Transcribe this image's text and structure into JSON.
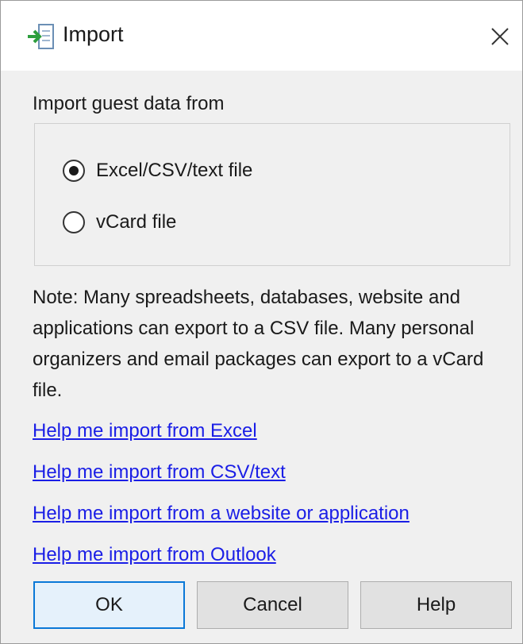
{
  "window": {
    "title": "Import",
    "title_icon": "import-arrow-icon",
    "close_icon": "close-icon"
  },
  "group": {
    "label": "Import guest data from",
    "options": [
      {
        "label": "Excel/CSV/text file",
        "selected": true
      },
      {
        "label": "vCard file",
        "selected": false
      }
    ]
  },
  "note": "Note: Many spreadsheets, databases, website and applications can export to a CSV file. Many personal organizers and email packages can export to a vCard file.",
  "links": [
    "Help me import from Excel",
    "Help me import from CSV/text",
    "Help me import from a website or application",
    "Help me import from Outlook"
  ],
  "buttons": {
    "ok": "OK",
    "cancel": "Cancel",
    "help": "Help"
  },
  "colors": {
    "link": "#1a1ee6",
    "accent": "#0a78d7",
    "icon_arrow": "#2e9e3e"
  }
}
